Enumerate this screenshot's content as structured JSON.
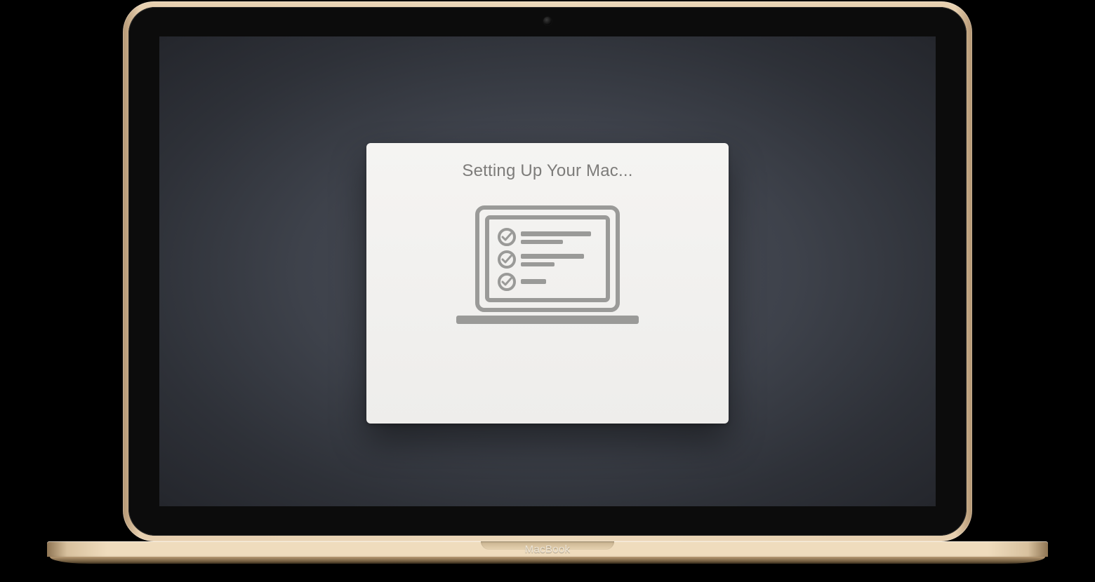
{
  "device": {
    "brand_label": "MacBook"
  },
  "setup_dialog": {
    "title": "Setting Up Your Mac..."
  }
}
